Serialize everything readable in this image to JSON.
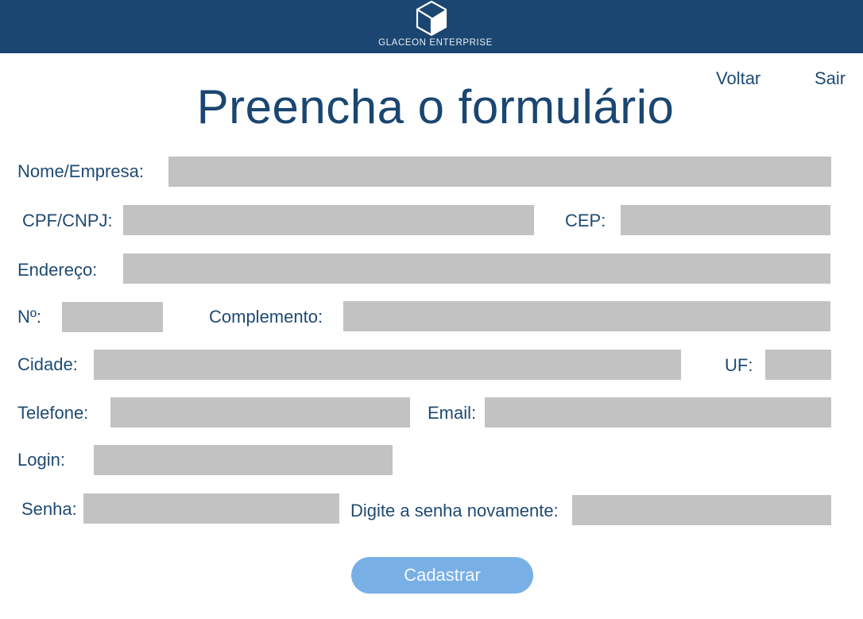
{
  "header": {
    "brand_name": "GLACEON ENTERPRISE",
    "logo_icon": "cube-icon",
    "background_color": "#1a4671"
  },
  "nav": {
    "back_label": "Voltar",
    "exit_label": "Sair"
  },
  "page": {
    "title": "Preencha o formulário"
  },
  "form": {
    "name_label": "Nome/Empresa:",
    "cpf_label": "CPF/CNPJ:",
    "cep_label": "CEP:",
    "address_label": "Endereço:",
    "number_label": "Nº:",
    "complement_label": "Complemento:",
    "city_label": "Cidade:",
    "uf_label": "UF:",
    "phone_label": "Telefone:",
    "email_label": "Email:",
    "login_label": "Login:",
    "password_label": "Senha:",
    "password_confirm_label": "Digite a senha novamente:",
    "field_color": "#c2c2c2"
  },
  "submit": {
    "label": "Cadastrar",
    "color": "#78b0e6"
  }
}
